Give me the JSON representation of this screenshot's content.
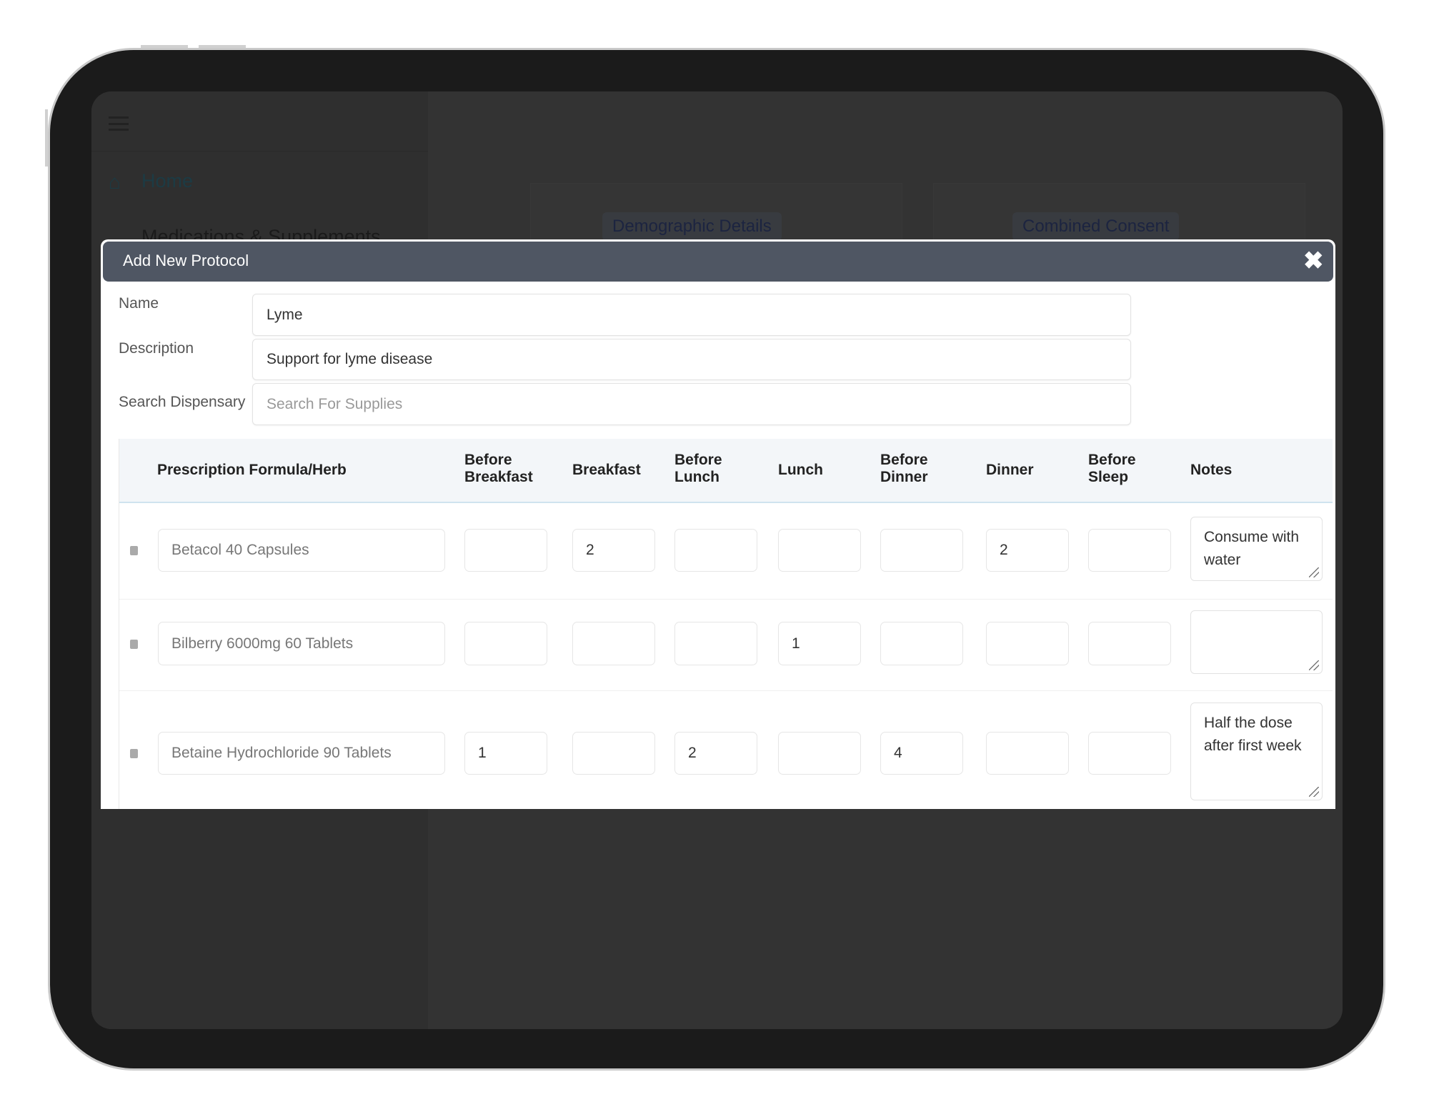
{
  "background_app": {
    "sidebar": {
      "home_label": "Home",
      "medications_label": "Medications & Supplements"
    },
    "buttons": {
      "demographic": "Demographic Details",
      "consent": "Combined Consent"
    }
  },
  "dialog": {
    "title": "Add New Protocol",
    "close_icon": "close-x",
    "fields": {
      "name_label": "Name",
      "name_value": "Lyme",
      "description_label": "Description",
      "description_value": "Support for lyme disease",
      "search_label": "Search Dispensary",
      "search_placeholder": "Search For Supplies"
    },
    "table": {
      "headers": [
        "Prescription Formula/Herb",
        "Before\nBreakfast",
        "Breakfast",
        "Before\nLunch",
        "Lunch",
        "Before\nDinner",
        "Dinner",
        "Before\nSleep",
        "Notes"
      ],
      "rows": [
        {
          "formula": "Betacol  40 Capsules",
          "doses": [
            "",
            "2",
            "",
            "",
            "",
            "2",
            ""
          ],
          "notes": "Consume with water"
        },
        {
          "formula": "Bilberry 6000mg  60 Tablets",
          "doses": [
            "",
            "",
            "",
            "1",
            "",
            "",
            ""
          ],
          "notes": ""
        },
        {
          "formula": "Betaine Hydrochloride  90 Tablets",
          "doses": [
            "1",
            "",
            "2",
            "",
            "4",
            "",
            ""
          ],
          "notes": "Half the dose after first week"
        }
      ]
    }
  }
}
